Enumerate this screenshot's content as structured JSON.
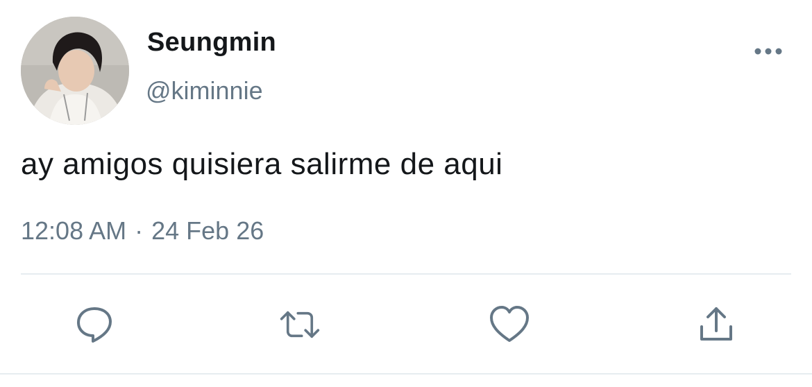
{
  "user": {
    "display_name": "Seungmin",
    "handle": "@kiminnie"
  },
  "tweet": {
    "text": "ay amigos quisiera salirme de aqui",
    "time": "12:08 AM",
    "separator": "·",
    "date": "24 Feb 26"
  },
  "actions": {
    "reply_icon": "comment-bubble-icon",
    "retweet_icon": "retweet-arrows-icon",
    "like_icon": "heart-icon",
    "share_icon": "share-upload-icon"
  },
  "colors": {
    "text_primary": "#14171a",
    "text_secondary": "#657786",
    "divider": "#e6ecf0",
    "background": "#ffffff"
  }
}
